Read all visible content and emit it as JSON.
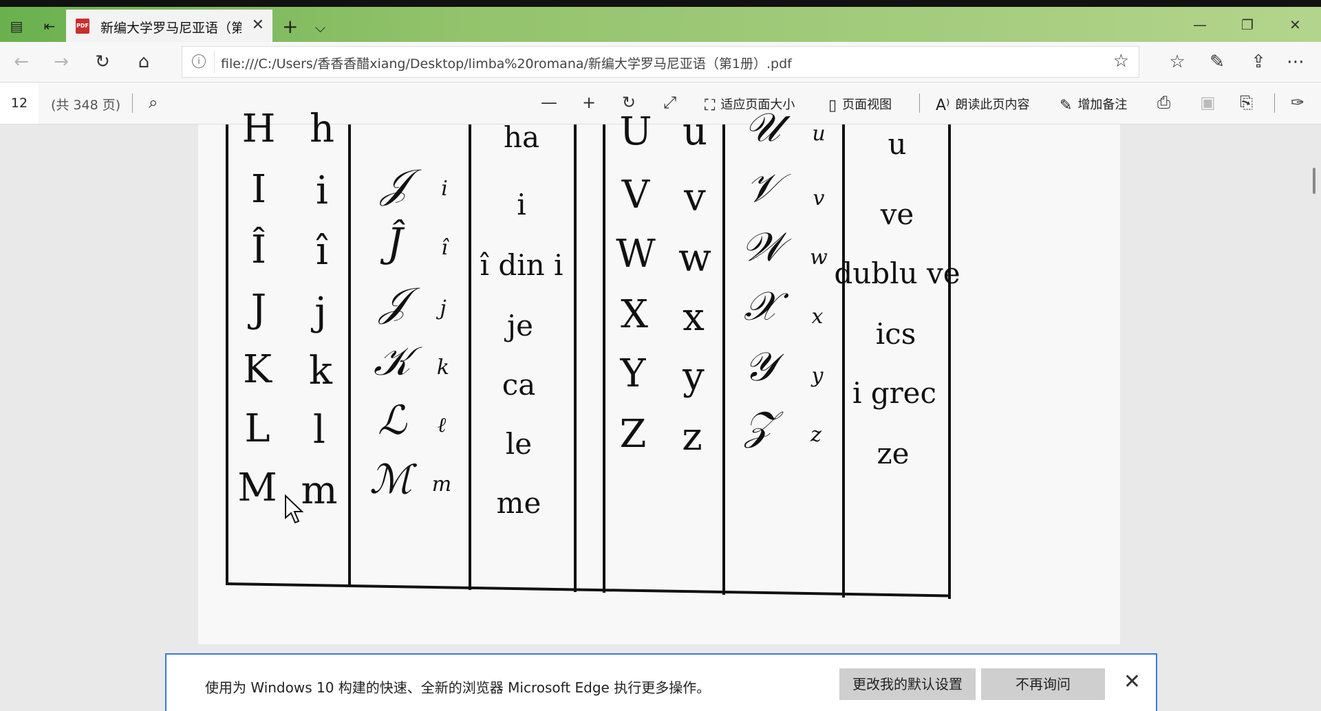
{
  "tab": {
    "title": "新编大学罗马尼亚语（第",
    "close": "✕"
  },
  "tabbar_icons": {
    "tab_manager": "tabs-icon",
    "set_aside": "set-aside-tabs-icon",
    "new_tab": "+",
    "tab_list": "⌵"
  },
  "window_controls": {
    "minimize": "—",
    "restore": "❐",
    "close": "✕"
  },
  "nav": {
    "back": "←",
    "forward": "→",
    "refresh": "↻",
    "home": "⌂"
  },
  "address": {
    "url": "file:///C:/Users/香香香醋xiang/Desktop/limba%20romana/新编大学罗马尼亚语（第1册）.pdf",
    "info_icon": "i"
  },
  "toolbar_right": {
    "favorites": "☆",
    "notes": "✎",
    "share": "⇪",
    "more": "⋯"
  },
  "pdf": {
    "page_number": "12",
    "page_count": "(共 348 页)",
    "fit_page": "适应页面大小",
    "page_view": "页面视图",
    "read_aloud": "朗读此页内容",
    "add_notes": "增加备注"
  },
  "alphabet": {
    "left": {
      "upper": [
        "H",
        "I",
        "Î",
        "J",
        "K",
        "L",
        "M"
      ],
      "lower": [
        "h",
        "i",
        "î",
        "j",
        "k",
        "l",
        "m"
      ],
      "script_upper": [
        "",
        "𝒥",
        "Ĵ",
        "𝒥",
        "𝒦",
        "ℒ",
        "ℳ"
      ],
      "script_lower": [
        "",
        "i",
        "î",
        "j",
        "k",
        "ℓ",
        "m"
      ],
      "names": [
        "ha",
        "i",
        "î din i",
        "je",
        "ca",
        "le",
        "me"
      ]
    },
    "right": {
      "upper": [
        "U",
        "V",
        "W",
        "X",
        "Y",
        "Z"
      ],
      "lower": [
        "u",
        "v",
        "w",
        "x",
        "y",
        "z"
      ],
      "script_upper": [
        "𝒰",
        "𝒱",
        "𝒲",
        "𝒳",
        "𝒴",
        "𝒵"
      ],
      "script_lower": [
        "u",
        "v",
        "w",
        "x",
        "y",
        "z"
      ],
      "names": [
        "u",
        "ve",
        "dublu ve",
        "ics",
        "i grec",
        "ze"
      ]
    }
  },
  "banner": {
    "message": "使用为 Windows 10 构建的快速、全新的浏览器 Microsoft Edge 执行更多操作。",
    "primary_button": "更改我的默认设置",
    "secondary_button": "不再询问",
    "close": "✕"
  }
}
